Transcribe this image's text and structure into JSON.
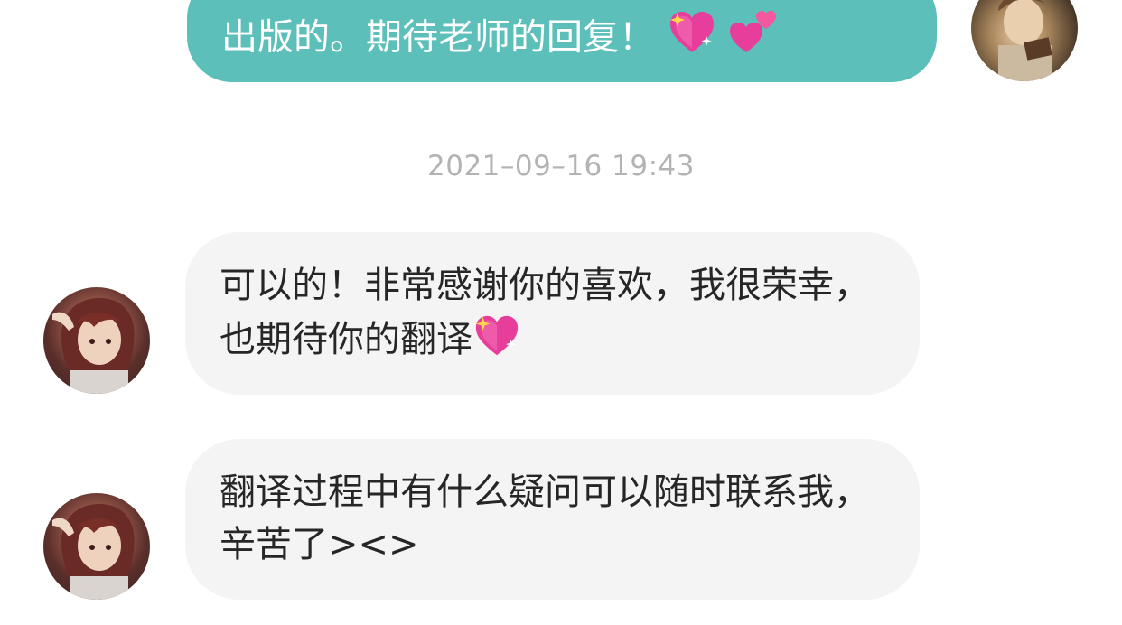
{
  "messages": {
    "outgoing_1": {
      "text": "出版的。期待老师的回复！",
      "emoji": [
        "sparkling-heart",
        "two-hearts"
      ]
    },
    "timestamp": "2021–09–16 19:43",
    "incoming_1": {
      "text": "可以的！非常感谢你的喜欢，我很荣幸，也期待你的翻译",
      "emoji": [
        "sparkling-heart"
      ]
    },
    "incoming_2": {
      "text": "翻译过程中有什么疑问可以随时联系我，辛苦了><>"
    }
  },
  "colors": {
    "outgoing_bubble": "#5dbfba",
    "incoming_bubble": "#f4f4f4",
    "timestamp": "#b3b3b3"
  }
}
